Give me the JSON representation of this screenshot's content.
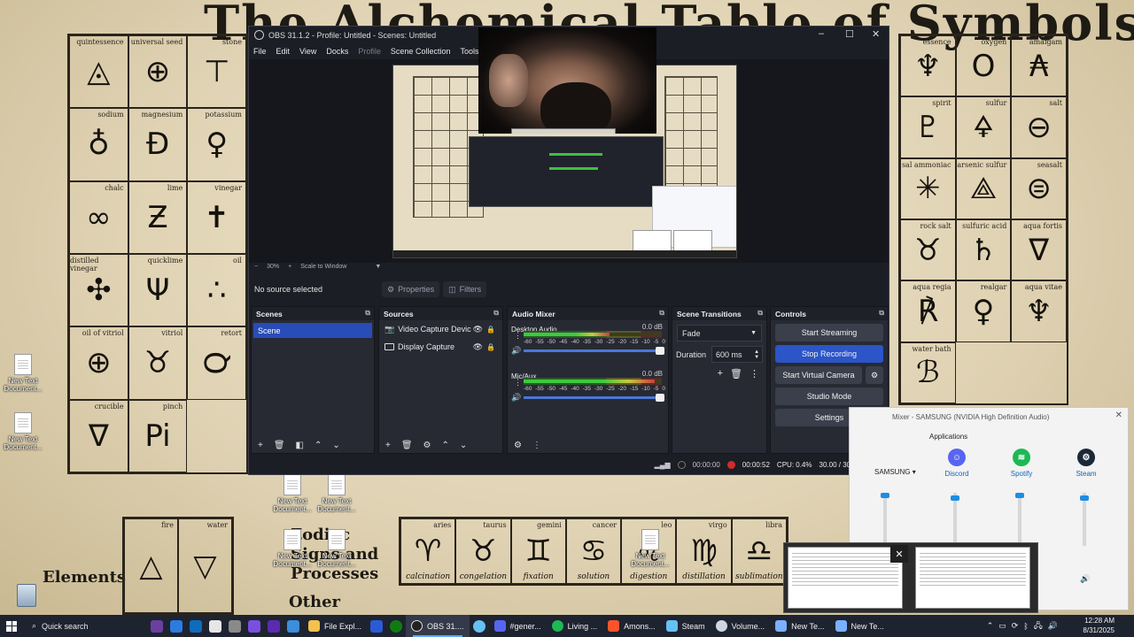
{
  "wallpaper": {
    "title": "The Alchemical Table of Symbols",
    "cells_left": [
      {
        "label": "quintessence",
        "symbol": "◬"
      },
      {
        "label": "universal seed",
        "symbol": "⊕"
      },
      {
        "label": "stone",
        "symbol": "⊤"
      },
      {
        "label": "sodium",
        "symbol": "♁"
      },
      {
        "label": "magnesium",
        "symbol": "Ð"
      },
      {
        "label": "potassium",
        "symbol": "♀"
      },
      {
        "label": "chalc",
        "symbol": "∞"
      },
      {
        "label": "lime",
        "symbol": "Ƶ"
      },
      {
        "label": "vinegar",
        "symbol": "✝"
      },
      {
        "label": "distilled vinegar",
        "symbol": "✣"
      },
      {
        "label": "quicklime",
        "symbol": "Ψ"
      },
      {
        "label": "oil",
        "symbol": "∴"
      },
      {
        "label": "oil of vitriol",
        "symbol": "⊕"
      },
      {
        "label": "vitriol",
        "symbol": "♉"
      },
      {
        "label": "retort",
        "symbol": "℺"
      },
      {
        "label": "crucible",
        "symbol": "∇"
      },
      {
        "label": "pinch",
        "symbol": "Pi"
      }
    ],
    "cells_right": [
      {
        "label": "essence",
        "symbol": "♆"
      },
      {
        "label": "oxygen",
        "symbol": "O"
      },
      {
        "label": "amalgam",
        "symbol": "₳"
      },
      {
        "label": "spirit",
        "symbol": "♇"
      },
      {
        "label": "sulfur",
        "symbol": "🜍"
      },
      {
        "label": "salt",
        "symbol": "⊖"
      },
      {
        "label": "sal ammoniac",
        "symbol": "✳"
      },
      {
        "label": "arsenic sulfur",
        "symbol": "⟁"
      },
      {
        "label": "seasalt",
        "symbol": "⊜"
      },
      {
        "label": "rock salt",
        "symbol": "♉"
      },
      {
        "label": "sulfuric acid",
        "symbol": "♄"
      },
      {
        "label": "aqua fortis",
        "symbol": "∇"
      },
      {
        "label": "aqua regia",
        "symbol": "℟"
      },
      {
        "label": "realgar",
        "symbol": "♀"
      },
      {
        "label": "aqua vitae",
        "symbol": "♆"
      },
      {
        "label": "water bath",
        "symbol": "ℬ"
      }
    ],
    "bottom_title": "Zodiac Signs and Processes",
    "elements_title": "Elements",
    "other_title": "Other",
    "zodiac": [
      {
        "label": "aries",
        "symbol": "♈",
        "sub": "calcination"
      },
      {
        "label": "taurus",
        "symbol": "♉",
        "sub": "congelation"
      },
      {
        "label": "gemini",
        "symbol": "♊",
        "sub": "fixation"
      },
      {
        "label": "cancer",
        "symbol": "♋",
        "sub": "solution"
      },
      {
        "label": "leo",
        "symbol": "♌",
        "sub": "digestion"
      },
      {
        "label": "virgo",
        "symbol": "♍",
        "sub": "distillation"
      },
      {
        "label": "libra",
        "symbol": "♎",
        "sub": "sublimation"
      }
    ],
    "elements": [
      {
        "label": "fire",
        "symbol": "△"
      },
      {
        "label": "water",
        "symbol": "▽"
      }
    ]
  },
  "desktop_icons": [
    {
      "label": "New Text Document..."
    },
    {
      "label": "New Text Document..."
    },
    {
      "label": "New Text Document..."
    },
    {
      "label": "New Text Document..."
    },
    {
      "label": "New Text Document..."
    },
    {
      "label": "New Text Document..."
    },
    {
      "label": "New Text Document..."
    }
  ],
  "obs": {
    "title": "OBS 31.1.2 - Profile: Untitled - Scenes: Untitled",
    "menu": [
      "File",
      "Edit",
      "View",
      "Docks",
      "Profile",
      "Scene Collection",
      "Tools"
    ],
    "zoom": "30%",
    "scale_label": "Scale to Window",
    "no_source": "No source selected",
    "properties_label": "Properties",
    "filters_label": "Filters",
    "docks": {
      "scenes": {
        "title": "Scenes",
        "items": [
          "Scene"
        ]
      },
      "sources": {
        "title": "Sources",
        "items": [
          "Video Capture Devic",
          "Display Capture"
        ]
      },
      "mixer": {
        "title": "Audio Mixer",
        "channels": [
          {
            "name": "Desktop Audio",
            "db": "0.0 dB",
            "level": 0.62
          },
          {
            "name": "Mic/Aux",
            "db": "0.0 dB",
            "level": 0.95
          }
        ],
        "ticks": [
          "-60",
          "-55",
          "-50",
          "-45",
          "-40",
          "-35",
          "-30",
          "-25",
          "-20",
          "-15",
          "-10",
          "-5",
          "0"
        ]
      },
      "transitions": {
        "title": "Scene Transitions",
        "type": "Fade",
        "duration_label": "Duration",
        "duration": "600 ms"
      },
      "controls": {
        "title": "Controls",
        "start_streaming": "Start Streaming",
        "stop_recording": "Stop Recording",
        "start_virtual_camera": "Start Virtual Camera",
        "studio_mode": "Studio Mode",
        "settings": "Settings"
      }
    },
    "status": {
      "stream_time": "00:00:00",
      "rec_time": "00:00:52",
      "cpu": "CPU: 0.4%",
      "fps": "30.00 / 30.00 FPS"
    }
  },
  "volume_mixer": {
    "title": "Mixer - SAMSUNG (NVIDIA High Definition Audio)",
    "applications_label": "Applications",
    "device_label": "SAMSUNG",
    "apps": [
      {
        "name": "Discord",
        "color": "#5865F2",
        "level": 0.95
      },
      {
        "name": "Spotify",
        "color": "#1DB954",
        "level": 1.0
      },
      {
        "name": "Steam",
        "color": "#1b2838",
        "level": 0.95
      }
    ]
  },
  "taskbar": {
    "search": "Quick search",
    "apps": [
      {
        "label": "File Expl...",
        "color": "#f2c14e"
      },
      {
        "label": "OBS 31....",
        "color": "#ffffff",
        "active": true
      },
      {
        "label": "#gener...",
        "color": "#5865F2"
      },
      {
        "label": "Living ...",
        "color": "#1DB954"
      },
      {
        "label": "Amons...",
        "color": "#fb542b"
      },
      {
        "label": "Steam",
        "color": "#66c0f4"
      },
      {
        "label": "Volume...",
        "color": "#cfd6e2"
      },
      {
        "label": "New Te...",
        "color": "#7ab0ff"
      },
      {
        "label": "New Te...",
        "color": "#7ab0ff"
      }
    ],
    "time": "12:28 AM",
    "date": "8/31/2025"
  }
}
